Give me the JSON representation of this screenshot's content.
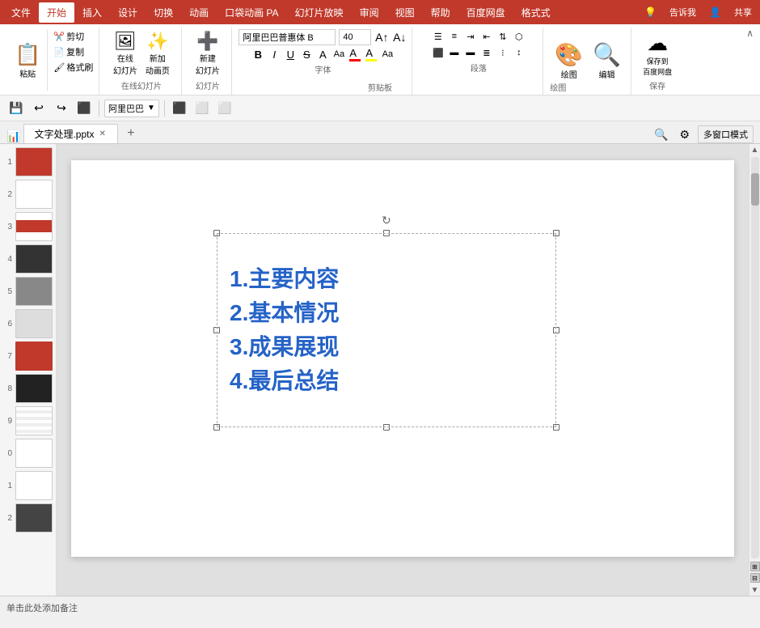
{
  "menubar": {
    "items": [
      "文件",
      "开始",
      "插入",
      "设计",
      "切换",
      "动画",
      "口袋动画 PA",
      "幻灯片放映",
      "审阅",
      "视图",
      "帮助",
      "百度网盘",
      "格式式"
    ],
    "active": "开始",
    "right_items": [
      "💡",
      "告诉我",
      "👤",
      "共享"
    ]
  },
  "ribbon": {
    "groups": [
      {
        "label": "剪贴板",
        "paste_label": "粘贴",
        "items": [
          "剪切",
          "复制",
          "格式刷"
        ]
      },
      {
        "label": "在线幻灯片",
        "items": [
          "在线\n幻灯片",
          "新加\n动画页"
        ]
      },
      {
        "label": "幻灯片",
        "items": [
          "新建\n幻灯片"
        ]
      },
      {
        "label": "字体",
        "font_name": "阿里巴巴普惠体 B",
        "font_size": "40",
        "bold": "B",
        "italic": "I",
        "underline": "U",
        "strikethrough": "S",
        "shadow": "A",
        "char_spacing": "Aa",
        "increase_font": "A↑",
        "decrease_font": "A↓",
        "font_color": "A"
      },
      {
        "label": "段落",
        "items": [
          "列表1",
          "列表2",
          "编号1",
          "编号2",
          "列表level"
        ]
      },
      {
        "label": "绘图",
        "items": [
          "绘图",
          "编辑"
        ]
      },
      {
        "label": "保存",
        "items": [
          "保存到\n百度网盘"
        ]
      }
    ]
  },
  "toolbar": {
    "items": [
      "save",
      "undo",
      "redo",
      "unknown"
    ],
    "dropdown_label": "阿里巴巴",
    "view_btns": [
      "normal",
      "outline",
      "more"
    ]
  },
  "tab": {
    "filename": "文字处理.pptx",
    "add_label": "+",
    "right_btns": [
      "🔍",
      "⚙",
      "多窗口模式"
    ]
  },
  "slides": [
    {
      "num": "1",
      "type": "red"
    },
    {
      "num": "2",
      "type": "blank"
    },
    {
      "num": "3",
      "type": "red_half"
    },
    {
      "num": "4",
      "type": "dark"
    },
    {
      "num": "5",
      "type": "gray"
    },
    {
      "num": "6",
      "type": "light"
    },
    {
      "num": "7",
      "type": "active_red"
    },
    {
      "num": "8",
      "type": "dark2"
    },
    {
      "num": "9",
      "type": "lines"
    },
    {
      "num": "0",
      "type": "blank2"
    },
    {
      "num": "1",
      "type": "blank3"
    },
    {
      "num": "2",
      "type": "dark3"
    }
  ],
  "slide_content": {
    "text_lines": [
      "1.主要内容",
      "2.基本情况",
      "3.成果展现",
      "4.最后总结"
    ]
  },
  "status_bar": {
    "notes_label": "单击此处添加备注"
  }
}
